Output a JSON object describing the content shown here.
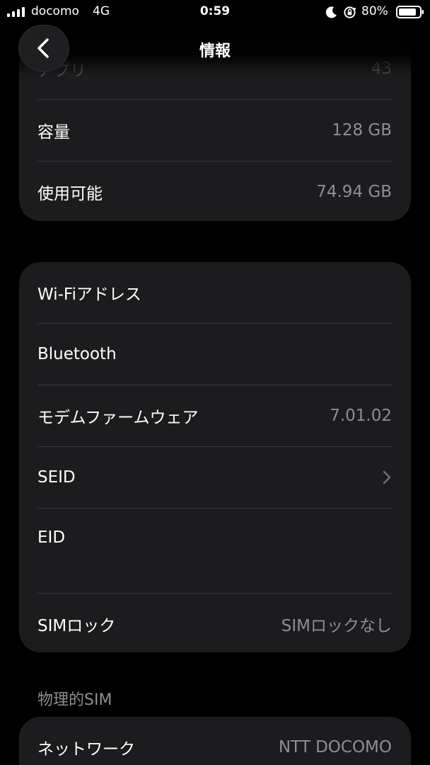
{
  "status_bar": {
    "carrier": "docomo",
    "network": "4G",
    "time": "0:59",
    "battery_percent": "80%"
  },
  "nav": {
    "title": "情報",
    "back_icon": "chevron-left-icon"
  },
  "group1": {
    "rows": [
      {
        "label": "アプリ",
        "value": "43"
      },
      {
        "label": "容量",
        "value": "128 GB"
      },
      {
        "label": "使用可能",
        "value": "74.94 GB"
      }
    ]
  },
  "group2": {
    "rows": [
      {
        "label": "Wi-Fiアドレス",
        "value": ""
      },
      {
        "label": "Bluetooth",
        "value": ""
      },
      {
        "label": "モデムファームウェア",
        "value": "7.01.02"
      },
      {
        "label": "SEID",
        "value": ""
      },
      {
        "label": "EID",
        "value": ""
      },
      {
        "label": "SIMロック",
        "value": "SIMロックなし"
      }
    ]
  },
  "section_physical_sim": {
    "header": "物理的SIM",
    "rows": [
      {
        "label": "ネットワーク",
        "value": "NTT DOCOMO"
      }
    ]
  },
  "colors": {
    "background": "#000000",
    "cell": "#1c1c1e",
    "secondary_text": "#8e8e93",
    "separator": "#38383a"
  }
}
